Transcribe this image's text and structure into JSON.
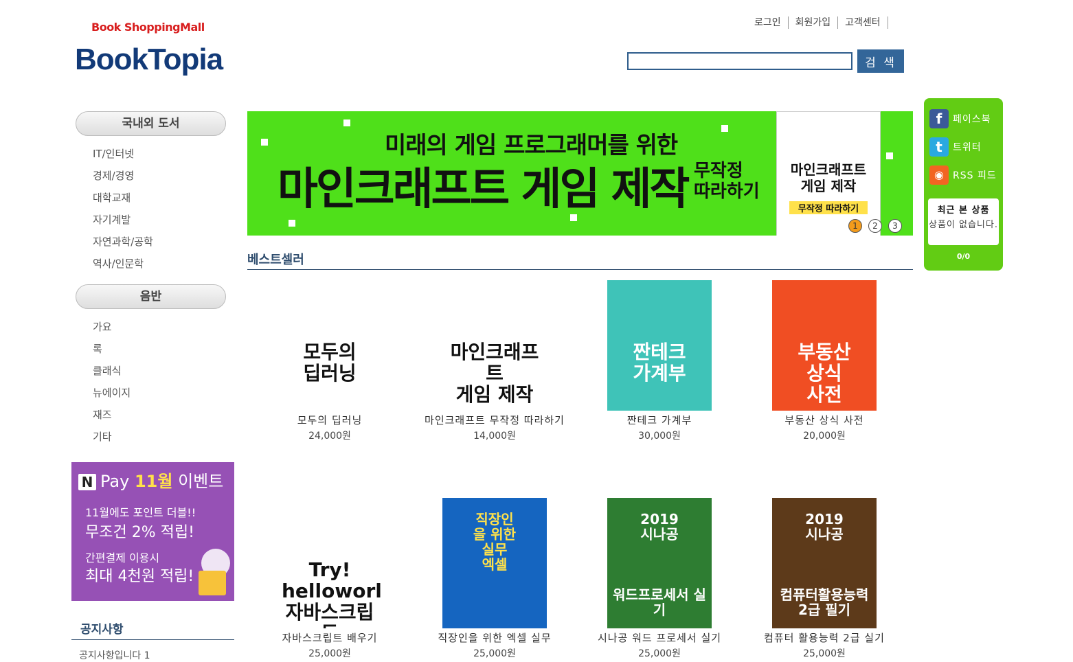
{
  "header": {
    "tagline": "Book ShoppingMall",
    "logo": "BookTopia",
    "links": [
      "로그인",
      "회원가입",
      "고객센터"
    ],
    "search_placeholder": "",
    "search_button": "검 색"
  },
  "sidebar": {
    "categories": [
      {
        "title": "국내외 도서",
        "items": [
          "IT/인터넷",
          "경제/경영",
          "대학교재",
          "자기계발",
          "자연과학/공학",
          "역사/인문학"
        ]
      },
      {
        "title": "음반",
        "items": [
          "가요",
          "록",
          "클래식",
          "뉴에이지",
          "재즈",
          "기타"
        ]
      }
    ],
    "ad": {
      "n": "N",
      "pay": "Pay",
      "month": "11월",
      "event": "이벤트",
      "line1": "11월에도 포인트 더블!!",
      "line2": "무조건 2% 적립!",
      "line3": "간편결제 이용시",
      "line4": "최대 4천원 적립!"
    },
    "notice_title": "공지사항",
    "notice_item": "공지사항입니다 1"
  },
  "banner": {
    "subtitle": "미래의 게임 프로그래머를 위한",
    "title": "마인크래프트 게임 제작",
    "side_line1": "무작정",
    "side_line2": "따라하기",
    "book_title_line1": "마인크래프트",
    "book_title_line2": "게임 제작",
    "book_sub": "무작정 따라하기",
    "dots": [
      "1",
      "2",
      "3"
    ],
    "active_dot": 1
  },
  "bestseller": {
    "title": "베스트셀러",
    "products": [
      {
        "name": "모두의 딥러닝",
        "price": "24,000원",
        "cover_text": "모두의\n딥러닝",
        "cover_bg": "#ffffff",
        "cover_fg": "#111111"
      },
      {
        "name": "마인크래프트 무작정 따라하기",
        "price": "14,000원",
        "cover_text": "마인크래프트\n게임 제작",
        "cover_bg": "#ffffff",
        "cover_fg": "#111111"
      },
      {
        "name": "짠테크 가계부",
        "price": "30,000원",
        "cover_text": "짠테크\n가계부",
        "cover_bg": "#3fc3b8",
        "cover_fg": "#ffffff"
      },
      {
        "name": "부동산 상식 사전",
        "price": "20,000원",
        "cover_text": "부동산\n상식\n사전",
        "cover_bg": "#f04e23",
        "cover_fg": "#ffffff"
      },
      {
        "name": "자바스크립트 배우기",
        "price": "25,000원",
        "cover_text": "Try!\nhelloworld\n자바스크립트",
        "cover_bg": "#ffffff",
        "cover_fg": "#111111"
      },
      {
        "name": "직장인을 위한 엑셀 실무",
        "price": "25,000원",
        "cover_text": "직장인\n을 위한\n실무\n엑셀",
        "cover_bg": "#1565c0",
        "cover_fg": "#ffe14a"
      },
      {
        "name": "시나공 워드 프로세서 실기",
        "price": "25,000원",
        "cover_text": "2019\n시나공\n\n\n\n워드프로세서 실기",
        "cover_bg": "#2e7d32",
        "cover_fg": "#ffffff"
      },
      {
        "name": "컴퓨터 활용능력 2급 실기",
        "price": "25,000원",
        "cover_text": "2019\n시나공\n\n\n\n컴퓨터활용능력2급 필기",
        "cover_bg": "#5d3a1a",
        "cover_fg": "#ffffff"
      }
    ]
  },
  "sns": {
    "items": [
      {
        "label": "페이스북",
        "icon": "facebook-icon",
        "glyph": "f",
        "color": "#3b5998"
      },
      {
        "label": "트위터",
        "icon": "twitter-icon",
        "glyph": "t",
        "color": "#2aa9e0"
      },
      {
        "label": "RSS 피드",
        "icon": "rss-icon",
        "glyph": "◉",
        "color": "#f26522"
      }
    ],
    "recent_title": "최근 본 상품",
    "recent_empty": "상품이 없습니다.",
    "recent_page": "0/0"
  }
}
